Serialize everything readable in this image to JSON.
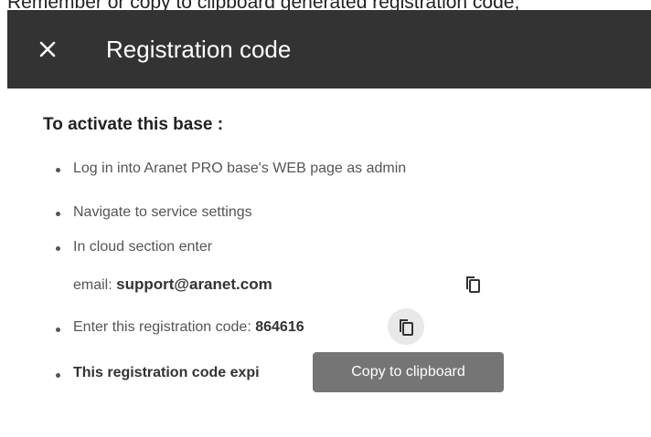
{
  "caption": "Remember or copy to clipboard generated registration code;",
  "dialog": {
    "title": "Registration code",
    "close_icon": "close-icon"
  },
  "instructions": {
    "heading": "To activate this base :",
    "step1": "Log in into Aranet PRO base's WEB page as admin",
    "step2": "Navigate to service settings",
    "step3_line1": "In cloud section enter",
    "step3_email_label": "email:",
    "step3_email_value": "support@aranet.com",
    "step4_prefix": "Enter this registration code:",
    "step4_code": "864616",
    "step5_visible": "This registration code expi"
  },
  "icons": {
    "copy_email": "copy-icon",
    "copy_code": "copy-icon"
  },
  "tooltip": {
    "text": "Copy to clipboard"
  },
  "colors": {
    "header_bg": "#333333",
    "header_text": "#ffffff",
    "tooltip_bg": "#6e6e6e",
    "body_text": "#555555"
  }
}
